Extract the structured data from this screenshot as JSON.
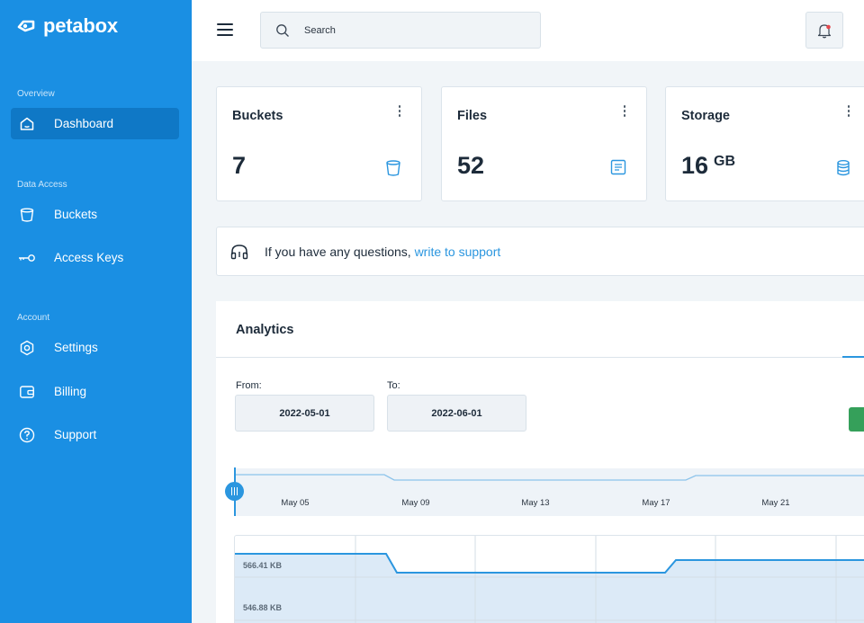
{
  "brand": {
    "name": "petabox"
  },
  "sidebar": {
    "sections": [
      {
        "title": "Overview",
        "items": [
          {
            "label": "Dashboard",
            "icon": "home-icon",
            "active": true
          }
        ]
      },
      {
        "title": "Data Access",
        "items": [
          {
            "label": "Buckets",
            "icon": "bucket-icon"
          },
          {
            "label": "Access Keys",
            "icon": "key-icon"
          }
        ]
      },
      {
        "title": "Account",
        "items": [
          {
            "label": "Settings",
            "icon": "settings-icon"
          },
          {
            "label": "Billing",
            "icon": "wallet-icon"
          },
          {
            "label": "Support",
            "icon": "help-icon"
          }
        ]
      }
    ]
  },
  "topbar": {
    "search_placeholder": "Search"
  },
  "stats": [
    {
      "title": "Buckets",
      "value": "7",
      "unit": "",
      "icon": "bucket-icon"
    },
    {
      "title": "Files",
      "value": "52",
      "unit": "",
      "icon": "file-icon"
    },
    {
      "title": "Storage",
      "value": "16",
      "unit": "GB",
      "icon": "database-icon"
    }
  ],
  "support_banner": {
    "text": "If you have any questions,",
    "link": "write to support"
  },
  "analytics": {
    "title": "Analytics",
    "from_label": "From:",
    "from_value": "2022-05-01",
    "to_label": "To:",
    "to_value": "2022-06-01",
    "timeline_ticks": [
      "May 05",
      "May 09",
      "May 13",
      "May 17",
      "May 21"
    ],
    "y_ticks": [
      "566.41 KB",
      "546.88 KB"
    ]
  },
  "colors": {
    "sidebar": "#1a8fe3",
    "accent": "#2b96df",
    "green": "#35a05a"
  }
}
